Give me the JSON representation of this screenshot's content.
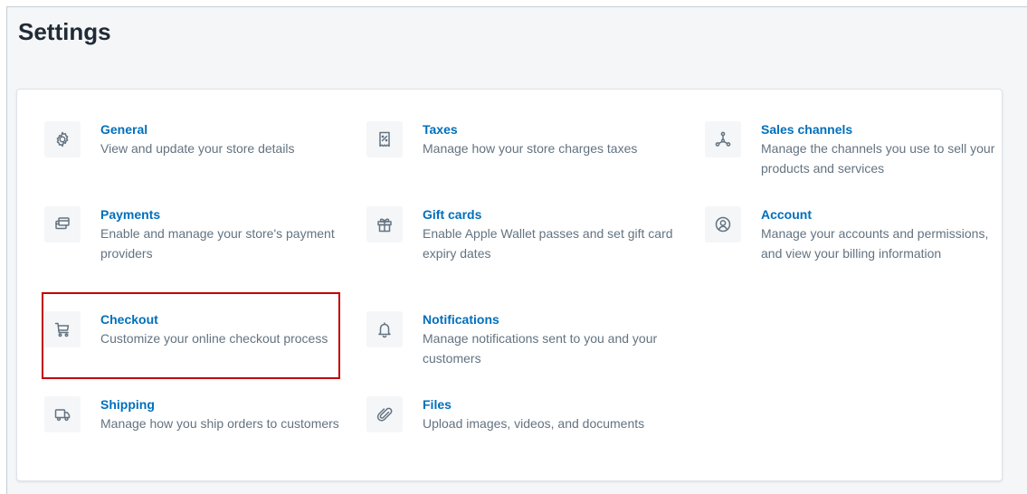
{
  "page": {
    "title": "Settings"
  },
  "items": {
    "general": {
      "title": "General",
      "desc": "View and update your store details"
    },
    "taxes": {
      "title": "Taxes",
      "desc": "Manage how your store charges taxes"
    },
    "sales_channels": {
      "title": "Sales channels",
      "desc": "Manage the channels you use to sell your products and services"
    },
    "payments": {
      "title": "Payments",
      "desc": "Enable and manage your store's payment providers"
    },
    "gift_cards": {
      "title": "Gift cards",
      "desc": "Enable Apple Wallet passes and set gift card expiry dates"
    },
    "account": {
      "title": "Account",
      "desc": "Manage your accounts and permissions, and view your billing information"
    },
    "checkout": {
      "title": "Checkout",
      "desc": "Customize your online checkout process"
    },
    "notifications": {
      "title": "Notifications",
      "desc": "Manage notifications sent to you and your customers"
    },
    "shipping": {
      "title": "Shipping",
      "desc": "Manage how you ship orders to customers"
    },
    "files": {
      "title": "Files",
      "desc": "Upload images, videos, and documents"
    }
  },
  "icons": {
    "general": "gear-icon",
    "taxes": "receipt-icon",
    "sales_channels": "channels-icon",
    "payments": "payment-icon",
    "gift_cards": "gift-icon",
    "account": "account-icon",
    "checkout": "cart-icon",
    "notifications": "bell-icon",
    "shipping": "truck-icon",
    "files": "paperclip-icon"
  },
  "colors": {
    "link": "#006fbb",
    "muted_text": "#637381",
    "highlight_border": "#c00000",
    "background": "#f4f6f8"
  }
}
